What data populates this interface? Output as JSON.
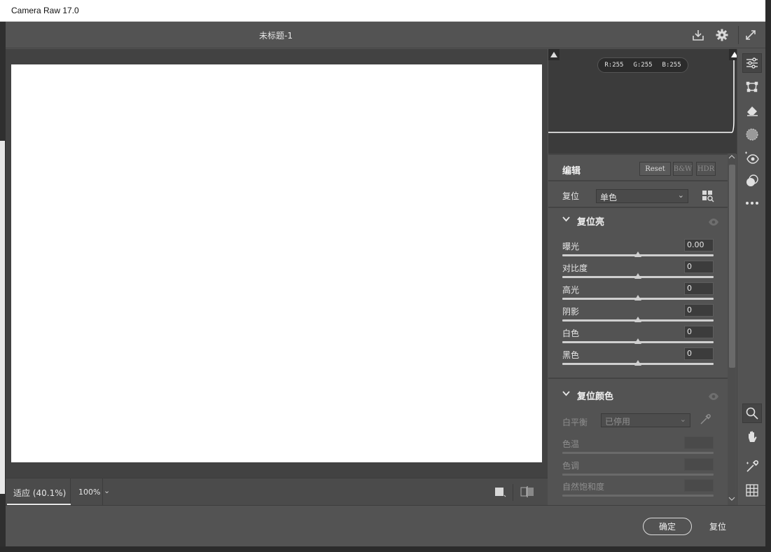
{
  "window": {
    "title": "Camera Raw 17.0"
  },
  "toolbar": {
    "doc_title": "未标题-1",
    "icons": [
      "save-icon",
      "gear-icon",
      "fullscreen-icon"
    ]
  },
  "histogram": {
    "r_label": "R:255",
    "g_label": "G:255",
    "b_label": "B:255"
  },
  "edit_panel": {
    "title": "编辑",
    "reset_btn": "Reset",
    "bw_btn": "B&W",
    "hdr_btn": "HDR",
    "reset_row": {
      "label": "复位",
      "select_value": "单色"
    }
  },
  "light_section": {
    "title": "复位亮",
    "sliders": [
      {
        "label": "曝光",
        "value": "0.00"
      },
      {
        "label": "对比度",
        "value": "0"
      },
      {
        "label": "高光",
        "value": "0"
      },
      {
        "label": "阴影",
        "value": "0"
      },
      {
        "label": "白色",
        "value": "0"
      },
      {
        "label": "黑色",
        "value": "0"
      }
    ]
  },
  "color_section": {
    "title": "复位颜色",
    "wb_label": "白平衡",
    "wb_value": "已停用",
    "sliders": [
      {
        "label": "色温",
        "value": ""
      },
      {
        "label": "色调",
        "value": ""
      },
      {
        "label": "自然饱和度",
        "value": ""
      }
    ]
  },
  "status_bar": {
    "fit_label": "适应 (40.1%)",
    "zoom_value": "100%"
  },
  "footer": {
    "ok_label": "确定",
    "cancel_label": "复位"
  },
  "rail_tools": [
    "sliders-icon",
    "crop-icon",
    "eraser-icon",
    "mask-icon",
    "redeye-icon",
    "presets-icon",
    "more-icon",
    "zoom-icon",
    "hand-icon",
    "eyedropper-icon",
    "grid-icon"
  ]
}
